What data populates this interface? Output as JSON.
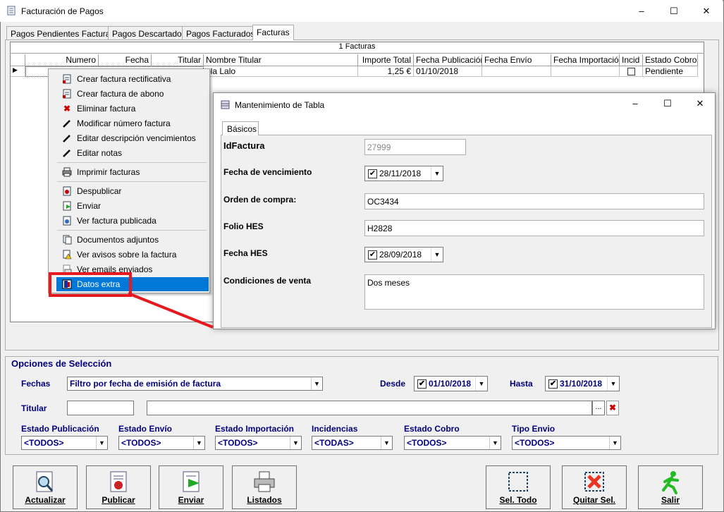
{
  "window": {
    "title": "Facturación de Pagos"
  },
  "tabs": [
    "Pagos Pendientes Facturar",
    "Pagos Descartados",
    "Pagos Facturados",
    "Facturas"
  ],
  "grid": {
    "caption": "1 Facturas",
    "columns": [
      "Numero",
      "Fecha",
      "Titular",
      "Nombre Titular",
      "Importe Total",
      "Fecha Publicación",
      "Fecha Envío",
      "Fecha Importación",
      "Incid",
      "Estado Cobro"
    ],
    "row": {
      "nombre": "ola Lalo",
      "importe": "1,25 €",
      "fecha_publicacion": "01/10/2018",
      "estado_cobro": "Pendiente"
    }
  },
  "context_menu": {
    "items": [
      {
        "label": "Crear factura rectificativa",
        "icon": "document-icon"
      },
      {
        "label": "Crear factura de abono",
        "icon": "document-icon"
      },
      {
        "label": "Eliminar factura",
        "icon": "red-x-icon"
      },
      {
        "label": "Modificar número factura",
        "icon": "pen-icon"
      },
      {
        "label": "Editar descripción vencimientos",
        "icon": "pen-icon"
      },
      {
        "label": "Editar notas",
        "icon": "pen-icon"
      },
      {
        "label": "Imprimir facturas",
        "icon": "printer-icon"
      },
      {
        "label": "Despublicar",
        "icon": "unpublish-icon"
      },
      {
        "label": "Enviar",
        "icon": "send-icon"
      },
      {
        "label": "Ver factura publicada",
        "icon": "document-icon"
      },
      {
        "label": "Documentos adjuntos",
        "icon": "attachment-icon"
      },
      {
        "label": "Ver avisos sobre la factura",
        "icon": "warning-icon"
      },
      {
        "label": "Ver emails enviados",
        "icon": "email-icon"
      },
      {
        "label": "Datos extra",
        "icon": "book-icon"
      }
    ]
  },
  "dialog": {
    "title": "Mantenimiento de Tabla",
    "tab": "Básicos",
    "fields": {
      "id_label": "IdFactura",
      "id_value": "27999",
      "venc_label": "Fecha de vencimiento",
      "venc_value": "28/11/2018",
      "orden_label": "Orden de compra:",
      "orden_value": "OC3434",
      "folio_label": "Folio HES",
      "folio_value": "H2828",
      "fecha_hes_label": "Fecha HES",
      "fecha_hes_value": "28/09/2018",
      "cond_label": "Condiciones de venta",
      "cond_value": "Dos meses"
    }
  },
  "options": {
    "title": "Opciones de Selección",
    "fechas_label": "Fechas",
    "fechas_value": "Filtro por fecha de emisión de factura",
    "desde_label": "Desde",
    "desde_value": "01/10/2018",
    "hasta_label": "Hasta",
    "hasta_value": "31/10/2018",
    "titular_label": "Titular",
    "filters": [
      {
        "label": "Estado Publicación",
        "value": "<TODOS>"
      },
      {
        "label": "Estado Envío",
        "value": "<TODOS>"
      },
      {
        "label": "Estado Importación",
        "value": "<TODOS>"
      },
      {
        "label": "Incidencias",
        "value": "<TODAS>"
      },
      {
        "label": "Estado Cobro",
        "value": "<TODOS>"
      },
      {
        "label": "Tipo Envio",
        "value": "<TODOS>"
      }
    ]
  },
  "buttons": {
    "actualizar": "Actualizar",
    "publicar": "Publicar",
    "enviar": "Enviar",
    "listados": "Listados",
    "sel_todo": "Sel. Todo",
    "quitar_sel": "Quitar Sel.",
    "salir": "Salir"
  },
  "colors": {
    "highlight": "#0078d7",
    "annotation": "#e8191e",
    "label_blue": "#000080"
  }
}
